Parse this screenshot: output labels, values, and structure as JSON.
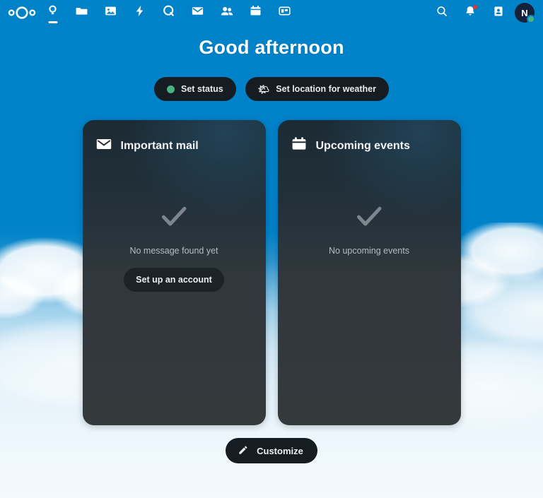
{
  "app": {
    "brand_blue": "#0082c9",
    "logo_name": "nextcloud-logo"
  },
  "navigation": {
    "left_items": [
      {
        "name": "dashboard",
        "label": "Dashboard",
        "icon": "dashboard-icon",
        "active": true
      },
      {
        "name": "files",
        "label": "Files",
        "icon": "folder-icon",
        "active": false
      },
      {
        "name": "photos",
        "label": "Photos",
        "icon": "photos-icon",
        "active": false
      },
      {
        "name": "activity",
        "label": "Activity",
        "icon": "lightning-bolt-icon",
        "active": false
      },
      {
        "name": "talk",
        "label": "Talk",
        "icon": "talk-icon",
        "active": false
      },
      {
        "name": "mail",
        "label": "Mail",
        "icon": "envelope-icon",
        "active": false
      },
      {
        "name": "contacts",
        "label": "Contacts",
        "icon": "contacts-people-icon",
        "active": false
      },
      {
        "name": "calendar",
        "label": "Calendar",
        "icon": "calendar-icon",
        "active": false
      },
      {
        "name": "deck",
        "label": "Deck",
        "icon": "deck-board-icon",
        "active": false
      }
    ],
    "right_items": [
      {
        "name": "unified-search",
        "label": "Search",
        "icon": "search-icon"
      },
      {
        "name": "notifications",
        "label": "Notifications",
        "icon": "bell-icon",
        "badge": true,
        "badge_color": "#e9322d"
      },
      {
        "name": "contacts-menu",
        "label": "Contacts",
        "icon": "contacts-card-icon"
      }
    ],
    "avatar": {
      "initial": "N",
      "status": "online",
      "status_color": "#49b382",
      "background": "#14213a"
    }
  },
  "greeting": {
    "text": "Good afternoon"
  },
  "status_chips": [
    {
      "name": "set-status",
      "label": "Set status",
      "icon": "online-status-dot",
      "icon_color": "#49b382"
    },
    {
      "name": "set-location-for-weather",
      "label": "Set location for weather",
      "icon": "sun-behind-cloud-emoji",
      "emoji": "🌤"
    }
  ],
  "widgets": [
    {
      "name": "important-mail",
      "title": "Important mail",
      "icon": "envelope-icon",
      "empty_icon": "check-icon",
      "empty_text": "No message found yet",
      "action_label": "Set up an account",
      "has_action": true
    },
    {
      "name": "upcoming-events",
      "title": "Upcoming events",
      "icon": "calendar-icon",
      "empty_icon": "check-icon",
      "empty_text": "No upcoming events",
      "action_label": "",
      "has_action": false
    }
  ],
  "footer": {
    "customize_label": "Customize",
    "customize_icon": "pencil-icon"
  }
}
